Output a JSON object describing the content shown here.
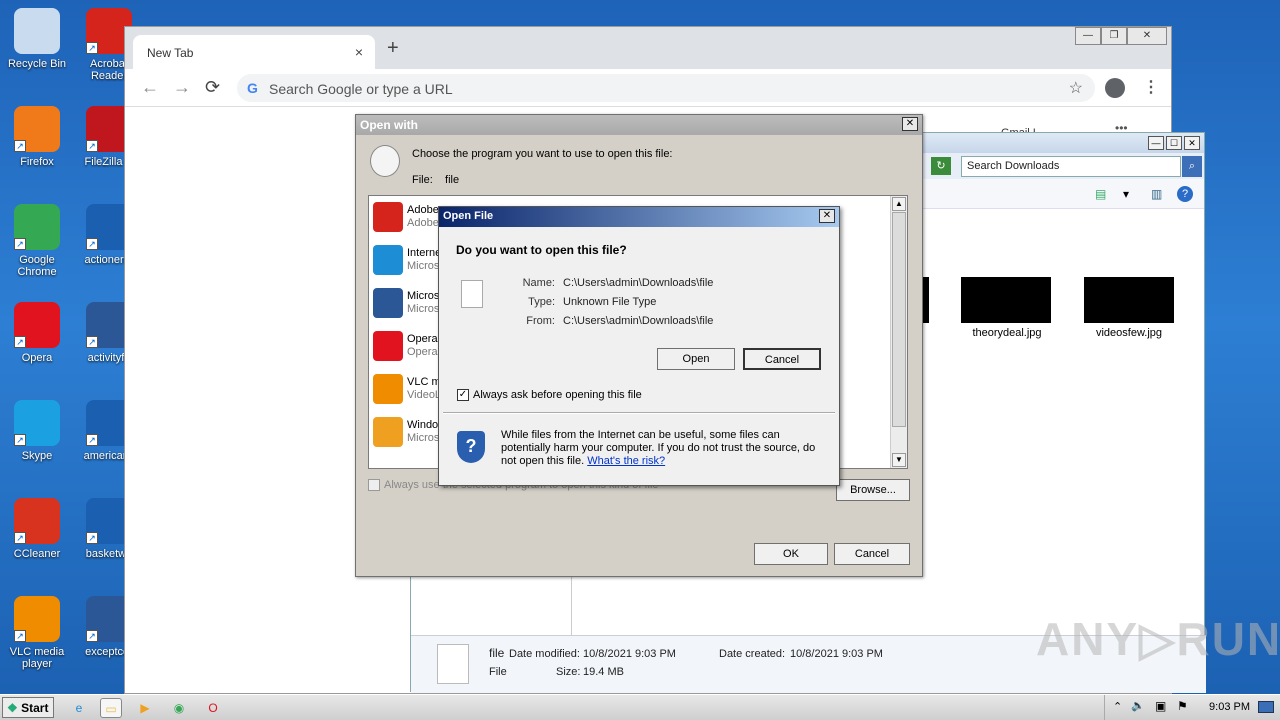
{
  "desktop": {
    "icons": [
      {
        "label": "Recycle Bin",
        "icon": "recycle-bin-icon",
        "color": "#c9dcef"
      },
      {
        "label": "Acrobat Reader",
        "icon": "acrobat-icon",
        "color": "#d4241c"
      },
      {
        "label": "Firefox",
        "icon": "firefox-icon",
        "color": "#f07a1a"
      },
      {
        "label": "FileZilla C",
        "icon": "filezilla-icon",
        "color": "#c0171e"
      },
      {
        "label": "Google Chrome",
        "icon": "chrome-icon",
        "color": "#34a853"
      },
      {
        "label": "actionerro",
        "icon": "document-icon",
        "color": "#1b5fb0"
      },
      {
        "label": "Opera",
        "icon": "opera-icon",
        "color": "#e0131f"
      },
      {
        "label": "activityfa",
        "icon": "word-icon",
        "color": "#2b5796"
      },
      {
        "label": "Skype",
        "icon": "skype-icon",
        "color": "#1ba1e2"
      },
      {
        "label": "americanc",
        "icon": "document-icon",
        "color": "#1b5fb0"
      },
      {
        "label": "CCleaner",
        "icon": "ccleaner-icon",
        "color": "#d8331f"
      },
      {
        "label": "basketwo",
        "icon": "document-icon",
        "color": "#1b5fb0"
      },
      {
        "label": "VLC media player",
        "icon": "vlc-icon",
        "color": "#f08c00"
      },
      {
        "label": "exceptcor",
        "icon": "word-icon",
        "color": "#2b5796"
      }
    ]
  },
  "browser": {
    "tab_title": "New Tab",
    "tab_close": "×",
    "new_tab": "+",
    "omnibox_placeholder": "Search Google or type a URL",
    "g_logo": "G",
    "back": "←",
    "forward": "→",
    "reload": "⟳",
    "star": "☆",
    "menu": "⋮",
    "win_minimize": "—",
    "win_restore": "❐",
    "win_close": "✕"
  },
  "explorer": {
    "search_placeholder": "Search Downloads",
    "refresh": "↻",
    "search_btn": "⌕",
    "peek_text": "Gmail  I",
    "peek_more": "•••",
    "cmd_icons": {
      "view": "▤",
      "dropdown": "▾",
      "pane": "▥",
      "help": "?"
    },
    "title_btns": {
      "min": "—",
      "max": "☐",
      "close": "✕"
    },
    "files": [
      {
        "name": "theorydeal.jpg"
      },
      {
        "name": "videosfew.jpg"
      }
    ],
    "details": {
      "name": "file",
      "type": "File",
      "date_modified_label": "Date modified:",
      "date_modified": "10/8/2021 9:03 PM",
      "size_label": "Size:",
      "size": "19.4 MB",
      "date_created_label": "Date created:",
      "date_created": "10/8/2021 9:03 PM"
    }
  },
  "open_with": {
    "title": "Open with",
    "close": "✕",
    "choose_text": "Choose the program you want to use to open this file:",
    "file_label": "File:",
    "file_value": "file",
    "programs": [
      {
        "n1": "Adobe",
        "n2": "Adobe",
        "color": "#d4241c",
        "icon": "acrobat-icon"
      },
      {
        "n1": "Interne",
        "n2": "Micros",
        "color": "#1d8ed6",
        "icon": "ie-icon"
      },
      {
        "n1": "Micros",
        "n2": "Micros",
        "color": "#2b5796",
        "icon": "word-icon"
      },
      {
        "n1": "Opera",
        "n2": "Opera",
        "color": "#e0131f",
        "icon": "opera-icon"
      },
      {
        "n1": "VLC me",
        "n2": "VideoL",
        "color": "#f08c00",
        "icon": "vlc-icon"
      },
      {
        "n1": "Windo",
        "n2": "Micros",
        "color": "#f0a020",
        "icon": "media-player-icon"
      }
    ],
    "always_use": "Always use the selected program to open this kind of file",
    "browse": "Browse...",
    "ok": "OK",
    "cancel": "Cancel"
  },
  "open_file": {
    "title": "Open File",
    "close": "✕",
    "question": "Do you want to open this file?",
    "name_label": "Name:",
    "name_value": "C:\\Users\\admin\\Downloads\\file",
    "type_label": "Type:",
    "type_value": "Unknown File Type",
    "from_label": "From:",
    "from_value": "C:\\Users\\admin\\Downloads\\file",
    "open": "Open",
    "cancel": "Cancel",
    "always_ask": "Always ask before opening this file",
    "checkmark": "✓",
    "shield": "?",
    "warning": "While files from the Internet can be useful, some files can potentially harm your computer. If you do not trust the source, do not open this file.",
    "risk_link": "What's the risk?"
  },
  "taskbar": {
    "start": "Start",
    "clock": "9:03 PM",
    "tray_icons": [
      "⌃",
      "🔈",
      "▣",
      "⚑"
    ],
    "items": [
      {
        "icon": "ie-icon",
        "glyph": "e",
        "color": "#1d8ed6"
      },
      {
        "icon": "explorer-icon",
        "glyph": "▭",
        "color": "#e8c050"
      },
      {
        "icon": "media-player-icon",
        "glyph": "▶",
        "color": "#f0a020"
      },
      {
        "icon": "chrome-icon",
        "glyph": "◉",
        "color": "#34a853"
      },
      {
        "icon": "opera-icon",
        "glyph": "O",
        "color": "#e0131f"
      }
    ]
  },
  "watermark": "ANY▷RUN"
}
